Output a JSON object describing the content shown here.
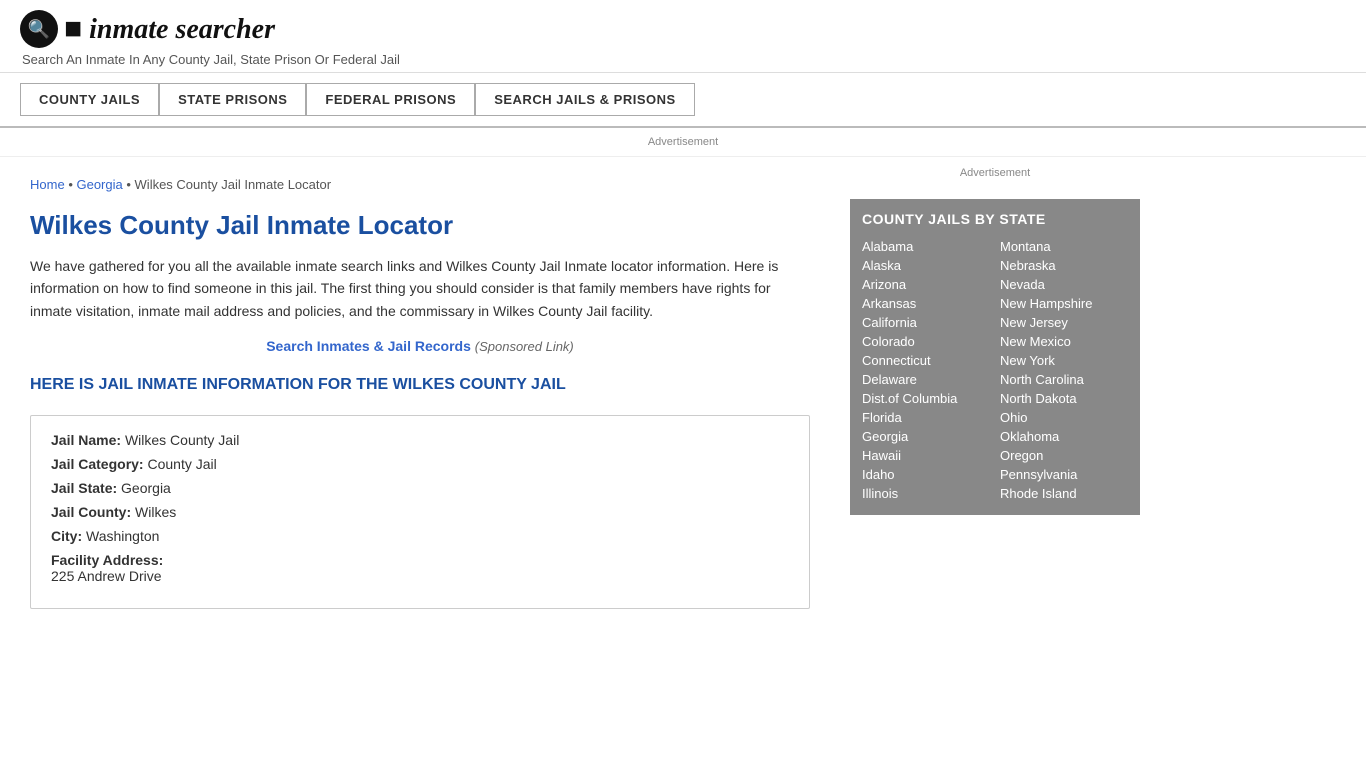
{
  "header": {
    "logo_icon": "🔍",
    "logo_text": "inmate searcher",
    "tagline": "Search An Inmate In Any County Jail, State Prison Or Federal Jail"
  },
  "nav": {
    "items": [
      {
        "id": "county-jails",
        "label": "COUNTY JAILS"
      },
      {
        "id": "state-prisons",
        "label": "STATE PRISONS"
      },
      {
        "id": "federal-prisons",
        "label": "FEDERAL PRISONS"
      },
      {
        "id": "search-jails",
        "label": "SEARCH JAILS & PRISONS"
      }
    ]
  },
  "ad_label": "Advertisement",
  "breadcrumb": {
    "home": "Home",
    "separator": "•",
    "state": "Georgia",
    "current": "Wilkes County Jail Inmate Locator"
  },
  "page_title": "Wilkes County Jail Inmate Locator",
  "description": "We have gathered for you all the available inmate search links and Wilkes County Jail Inmate locator information. Here is information on how to find someone in this jail. The first thing you should consider is that family members have rights for inmate visitation, inmate mail address and policies, and the commissary in Wilkes County Jail facility.",
  "sponsored": {
    "link_text": "Search Inmates & Jail Records",
    "note": "(Sponsored Link)"
  },
  "sub_heading": "HERE IS JAIL INMATE INFORMATION FOR THE WILKES COUNTY JAIL",
  "jail_info": {
    "name_label": "Jail Name:",
    "name_value": "Wilkes County Jail",
    "category_label": "Jail Category:",
    "category_value": "County Jail",
    "state_label": "Jail State:",
    "state_value": "Georgia",
    "county_label": "Jail County:",
    "county_value": "Wilkes",
    "city_label": "City:",
    "city_value": "Washington",
    "address_label": "Facility Address:",
    "address_value": "225 Andrew Drive"
  },
  "sidebar": {
    "ad_label": "Advertisement",
    "state_box_title": "COUNTY JAILS BY STATE",
    "states_col1": [
      "Alabama",
      "Alaska",
      "Arizona",
      "Arkansas",
      "California",
      "Colorado",
      "Connecticut",
      "Delaware",
      "Dist.of Columbia",
      "Florida",
      "Georgia",
      "Hawaii",
      "Idaho",
      "Illinois"
    ],
    "states_col2": [
      "Montana",
      "Nebraska",
      "Nevada",
      "New Hampshire",
      "New Jersey",
      "New Mexico",
      "New York",
      "North Carolina",
      "North Dakota",
      "Ohio",
      "Oklahoma",
      "Oregon",
      "Pennsylvania",
      "Rhode Island"
    ]
  }
}
